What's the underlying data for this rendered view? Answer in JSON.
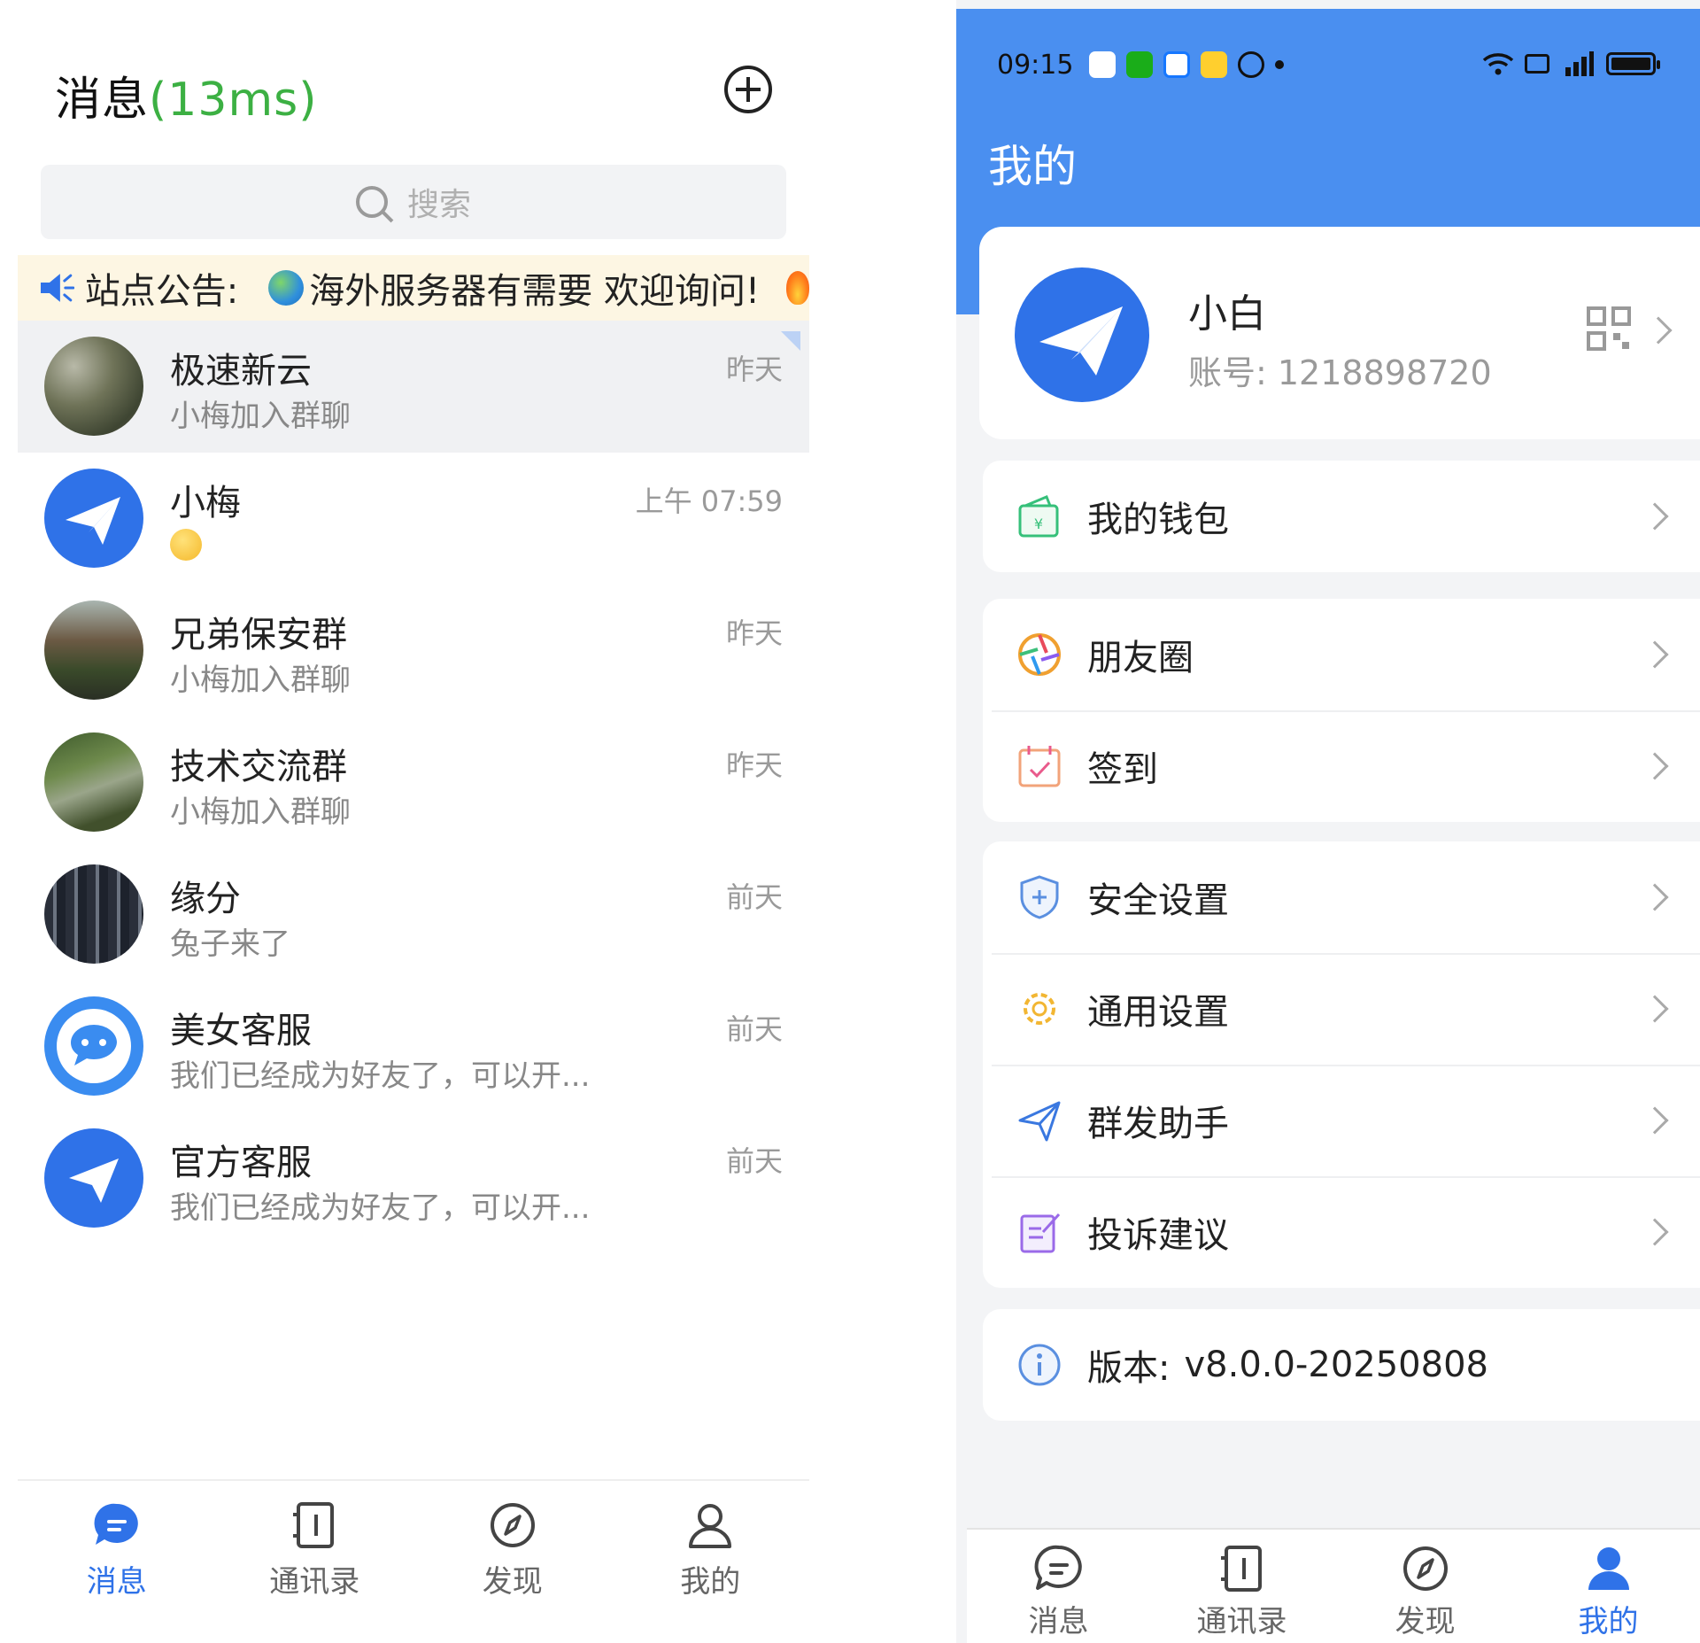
{
  "left": {
    "header": {
      "title": "消息",
      "latency": "(13ms)"
    },
    "search": {
      "placeholder": "搜索"
    },
    "notice": {
      "label": "站点公告:",
      "text": "海外服务器有需要 欢迎询问!"
    },
    "chats": [
      {
        "name": "极速新云",
        "preview": "小梅加入群聊",
        "time": "昨天",
        "avatar": "photo-garden",
        "pinned": true
      },
      {
        "name": "小梅",
        "preview": "",
        "time": "上午 07:59",
        "avatar": "paper-plane-blue",
        "preview_icon": "smile-emoji"
      },
      {
        "name": "兄弟保安群",
        "preview": "小梅加入群聊",
        "time": "昨天",
        "avatar": "photo-cabin"
      },
      {
        "name": "技术交流群",
        "preview": "小梅加入群聊",
        "time": "昨天",
        "avatar": "photo-forest-path"
      },
      {
        "name": "缘分",
        "preview": "兔子来了",
        "time": "前天",
        "avatar": "photo-server-rack"
      },
      {
        "name": "美女客服",
        "preview": "我们已经成为好友了，可以开...",
        "time": "前天",
        "avatar": "chat-bubble-blue"
      },
      {
        "name": "官方客服",
        "preview": "我们已经成为好友了，可以开...",
        "time": "前天",
        "avatar": "paper-plane-blue"
      }
    ],
    "tabbar": [
      {
        "label": "消息",
        "icon": "message-icon",
        "active": true
      },
      {
        "label": "通讯录",
        "icon": "contacts-icon",
        "active": false
      },
      {
        "label": "发现",
        "icon": "compass-icon",
        "active": false
      },
      {
        "label": "我的",
        "icon": "person-icon",
        "active": false
      }
    ]
  },
  "right": {
    "status": {
      "time": "09:15"
    },
    "title": "我的",
    "profile": {
      "name": "小白",
      "account": "账号: 1218898720"
    },
    "menu_groups": [
      [
        {
          "label": "我的钱包",
          "icon": "wallet-icon"
        }
      ],
      [
        {
          "label": "朋友圈",
          "icon": "aperture-icon"
        },
        {
          "label": "签到",
          "icon": "calendar-check-icon"
        }
      ],
      [
        {
          "label": "安全设置",
          "icon": "shield-icon"
        },
        {
          "label": "通用设置",
          "icon": "gear-icon"
        },
        {
          "label": "群发助手",
          "icon": "send-icon"
        },
        {
          "label": "投诉建议",
          "icon": "edit-icon"
        }
      ]
    ],
    "version": {
      "label": "版本:",
      "value": "v8.0.0-20250808"
    },
    "tabbar": [
      {
        "label": "消息",
        "icon": "message-icon",
        "active": false
      },
      {
        "label": "通讯录",
        "icon": "contacts-icon",
        "active": false
      },
      {
        "label": "发现",
        "icon": "compass-icon",
        "active": false
      },
      {
        "label": "我的",
        "icon": "person-icon",
        "active": true
      }
    ]
  },
  "colors": {
    "primary": "#2f72e8",
    "header_blue": "#4a8ff0",
    "latency_green": "#3cb043",
    "notice_bg": "#fdf6e3"
  }
}
